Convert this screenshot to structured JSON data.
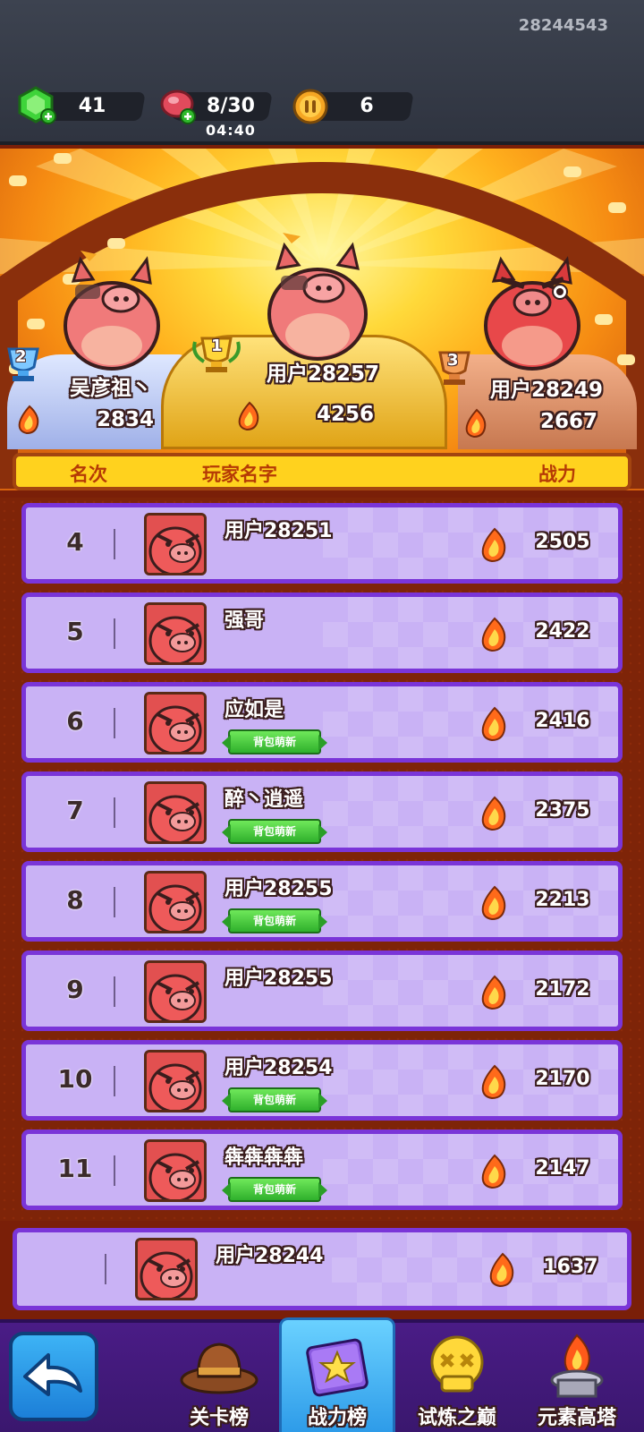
{
  "user_id": "28244543",
  "resources": {
    "gems": "41",
    "energy": "8/30",
    "energy_timer": "04:40",
    "coins": "6"
  },
  "podium": [
    {
      "place": "2",
      "name": "吴彦祖丶",
      "power": "2834"
    },
    {
      "place": "1",
      "name": "用户28257",
      "power": "4256"
    },
    {
      "place": "3",
      "name": "用户28249",
      "power": "2667"
    }
  ],
  "header": {
    "rank": "名次",
    "name": "玩家名字",
    "power": "战力"
  },
  "rows": [
    {
      "rank": "4",
      "name": "用户28251",
      "power": "2505",
      "badge": ""
    },
    {
      "rank": "5",
      "name": "强哥",
      "power": "2422",
      "badge": ""
    },
    {
      "rank": "6",
      "name": "应如是",
      "power": "2416",
      "badge": "背包萌新"
    },
    {
      "rank": "7",
      "name": "醉丶逍遥",
      "power": "2375",
      "badge": "背包萌新"
    },
    {
      "rank": "8",
      "name": "用户28255",
      "power": "2213",
      "badge": "背包萌新"
    },
    {
      "rank": "9",
      "name": "用户28255",
      "power": "2172",
      "badge": ""
    },
    {
      "rank": "10",
      "name": "用户28254",
      "power": "2170",
      "badge": "背包萌新"
    },
    {
      "rank": "11",
      "name": "犇犇犇犇",
      "power": "2147",
      "badge": "背包萌新"
    }
  ],
  "my_row": {
    "rank": "",
    "name": "用户28244",
    "power": "1637"
  },
  "nav": [
    {
      "label": "关卡榜"
    },
    {
      "label": "战力榜"
    },
    {
      "label": "试炼之巅"
    },
    {
      "label": "元素高塔"
    }
  ],
  "colors": {
    "accent_purple": "#7a35d8",
    "row_bg": "#c9b2f5",
    "header_yellow": "#ffd21e",
    "active_tab": "#2c9ae8"
  }
}
